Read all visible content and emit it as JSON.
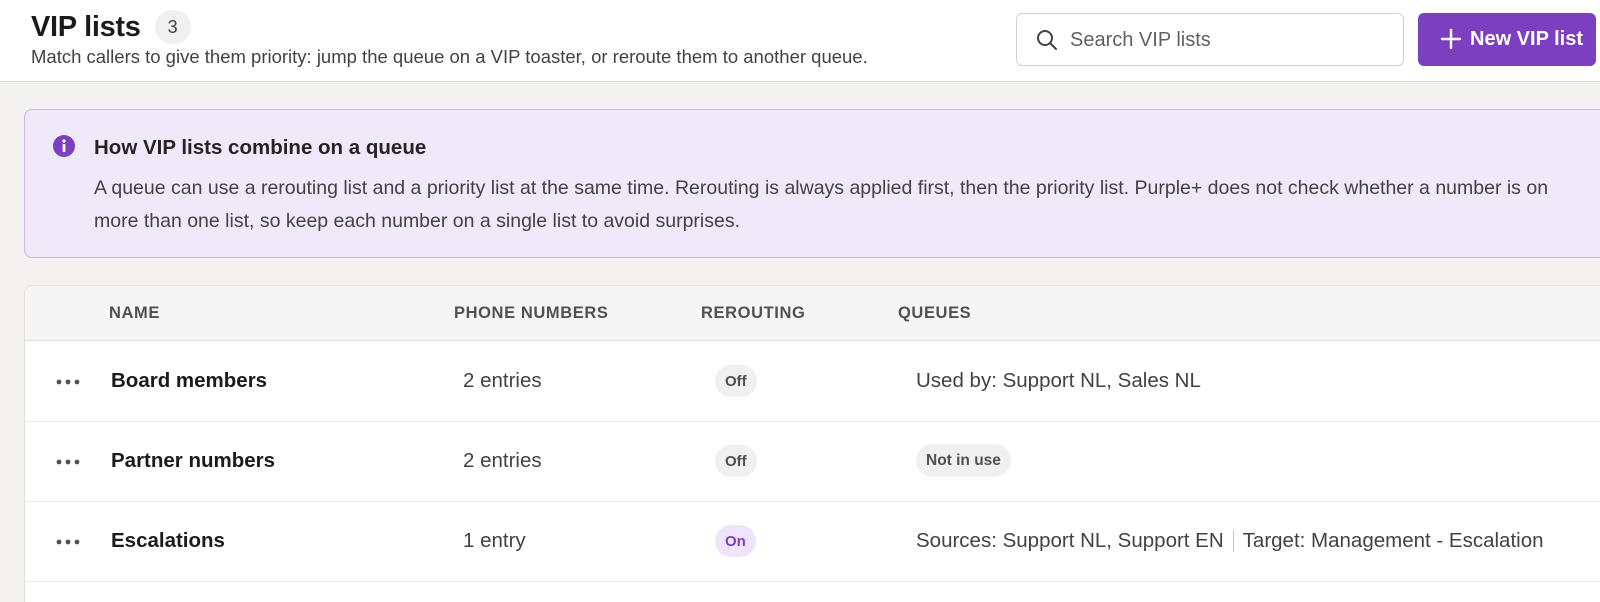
{
  "header": {
    "title": "VIP lists",
    "count": "3",
    "subtitle": "Match callers to give them priority: jump the queue on a VIP toaster, or reroute them to another queue.",
    "search_placeholder": "Search VIP lists",
    "new_button_label": "New VIP list",
    "search_icon": "search-icon",
    "new_button_icon": "plus-icon"
  },
  "info": {
    "icon": "info-icon",
    "heading": "How VIP lists combine on a queue",
    "body": "A queue can use a rerouting list and a priority list at the same time. Rerouting is always applied first, then the priority list. Purple+ does not check whether a number is on more than one list, so keep each number on a single list to avoid surprises."
  },
  "table": {
    "columns": [
      "NAME",
      "PHONE NUMBERS",
      "REROUTING",
      "QUEUES"
    ],
    "rows": [
      {
        "name": "Board members",
        "phones": "2 entries",
        "rerouting": "Off",
        "queues": "Used by: Support NL, Sales NL",
        "queues_sources": "",
        "queues_target": ""
      },
      {
        "name": "Partner numbers",
        "phones": "2 entries",
        "rerouting": "Off",
        "queues": "Not in use",
        "queues_sources": "",
        "queues_target": ""
      },
      {
        "name": "Escalations",
        "phones": "1 entry",
        "rerouting": "On",
        "queues": "",
        "queues_sources": "Sources: Support NL, Support EN",
        "queues_target": "Target: Management - Escalation"
      }
    ]
  },
  "colors": {
    "brand_purple": "#7b3fbf",
    "info_background": "#efe9fa",
    "info_border": "#c9b6ea"
  }
}
